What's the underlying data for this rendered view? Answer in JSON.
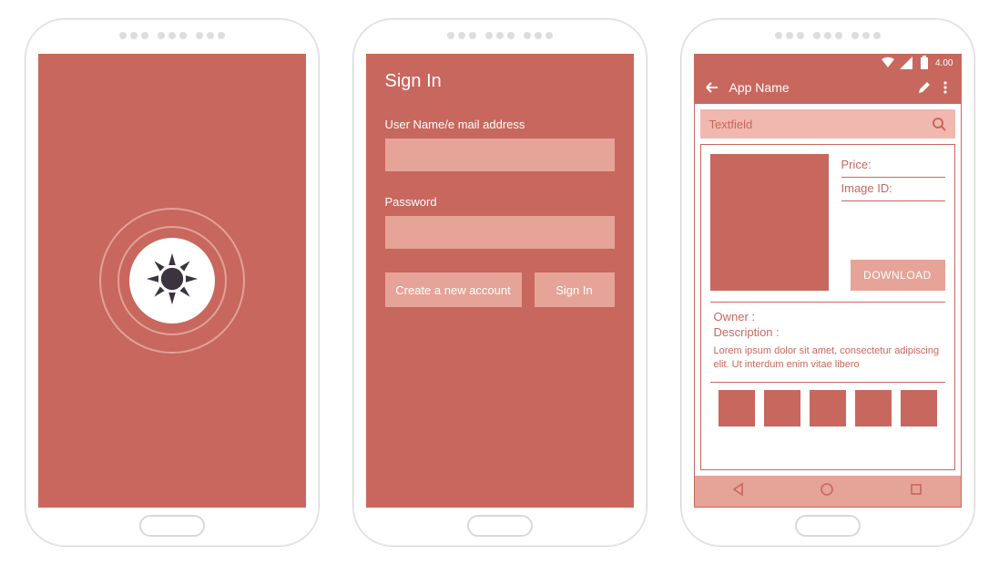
{
  "colors": {
    "brand": "#c8675d",
    "light": "#e6a397",
    "lighter": "#f0b8af",
    "icon_dark": "#3b343e"
  },
  "splash": {
    "logo": "sun-icon"
  },
  "signin": {
    "title": "Sign In",
    "username_label": "User Name/e mail address",
    "password_label": "Password",
    "create_button": "Create a new account",
    "signin_button": "Sign In"
  },
  "detail": {
    "status_time": "4.00",
    "app_name": "App Name",
    "search_placeholder": "Textfield",
    "price_label": "Price:",
    "imageid_label": "Image ID:",
    "download_label": "DOWNLOAD",
    "owner_label": "Owner :",
    "description_label": "Description :",
    "description_text": "Lorem ipsum dolor sit amet, consectetur adipiscing elit. Ut interdum enim vitae libero",
    "thumbnail_count": 5,
    "nav_icons": [
      "back-triangle",
      "circle",
      "square"
    ]
  }
}
